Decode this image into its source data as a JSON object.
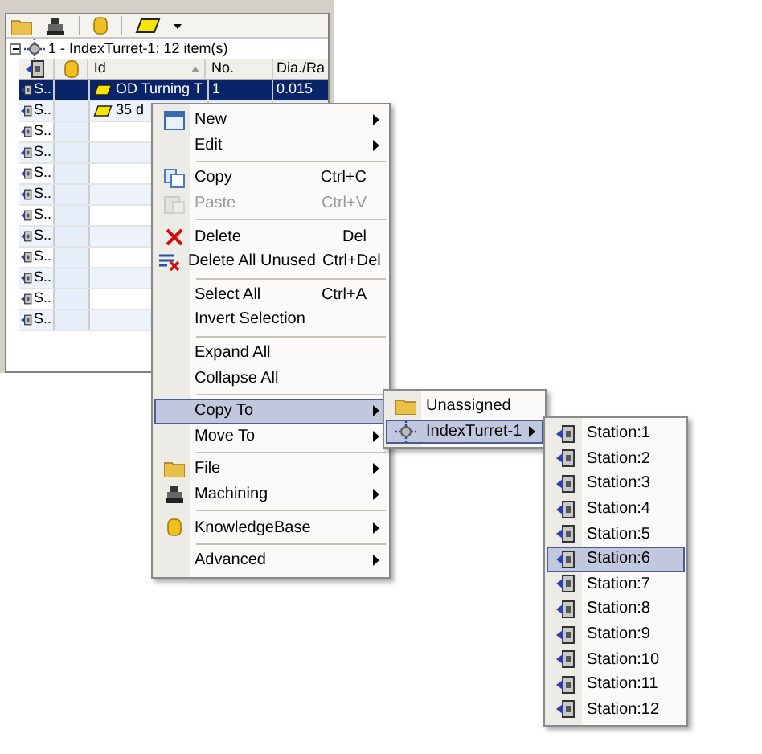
{
  "tree": {
    "label": "1 - IndexTurret-1: 12 item(s)",
    "expanded": true
  },
  "table": {
    "columns": [
      "Id",
      "No.",
      "Dia./Ra"
    ],
    "rows": [
      {
        "station": "S..",
        "id": "OD Turning T",
        "no": "1",
        "dia": "0.015",
        "selected": true
      },
      {
        "station": "S..",
        "id": "35 d",
        "selected": false
      },
      {
        "station": "S..",
        "selected": false
      },
      {
        "station": "S..",
        "selected": false
      },
      {
        "station": "S..",
        "selected": false
      },
      {
        "station": "S..",
        "selected": false
      },
      {
        "station": "S..",
        "selected": false
      },
      {
        "station": "S..",
        "selected": false
      },
      {
        "station": "S..",
        "selected": false
      },
      {
        "station": "S..",
        "selected": false
      },
      {
        "station": "S..",
        "selected": false
      },
      {
        "station": "S..",
        "selected": false
      }
    ]
  },
  "context_menu": {
    "items": [
      {
        "kind": "item",
        "label": "New",
        "submenu": true,
        "disabled": false,
        "selected": false
      },
      {
        "kind": "item",
        "label": "Edit",
        "submenu": true,
        "disabled": false,
        "selected": false
      },
      {
        "kind": "separator"
      },
      {
        "kind": "item",
        "label": "Copy",
        "shortcut": "Ctrl+C",
        "submenu": false,
        "disabled": false,
        "selected": false
      },
      {
        "kind": "item",
        "label": "Paste",
        "shortcut": "Ctrl+V",
        "submenu": false,
        "disabled": true,
        "selected": false
      },
      {
        "kind": "separator"
      },
      {
        "kind": "item",
        "label": "Delete",
        "shortcut": "Del",
        "submenu": false,
        "disabled": false,
        "selected": false
      },
      {
        "kind": "item",
        "label": "Delete All Unused",
        "shortcut": "Ctrl+Del",
        "submenu": false,
        "disabled": false,
        "selected": false
      },
      {
        "kind": "separator"
      },
      {
        "kind": "item",
        "label": "Select All",
        "shortcut": "Ctrl+A",
        "submenu": false,
        "disabled": false,
        "selected": false
      },
      {
        "kind": "item",
        "label": "Invert Selection",
        "submenu": false,
        "disabled": false,
        "selected": false
      },
      {
        "kind": "separator"
      },
      {
        "kind": "item",
        "label": "Expand All",
        "submenu": false,
        "disabled": false,
        "selected": false
      },
      {
        "kind": "item",
        "label": "Collapse All",
        "submenu": false,
        "disabled": false,
        "selected": false
      },
      {
        "kind": "separator"
      },
      {
        "kind": "item",
        "label": "Copy To",
        "submenu": true,
        "disabled": false,
        "selected": true
      },
      {
        "kind": "item",
        "label": "Move To",
        "submenu": true,
        "disabled": false,
        "selected": false
      },
      {
        "kind": "separator"
      },
      {
        "kind": "item",
        "label": "File",
        "submenu": true,
        "disabled": false,
        "selected": false
      },
      {
        "kind": "item",
        "label": "Machining",
        "submenu": true,
        "disabled": false,
        "selected": false
      },
      {
        "kind": "separator"
      },
      {
        "kind": "item",
        "label": "KnowledgeBase",
        "submenu": true,
        "disabled": false,
        "selected": false
      },
      {
        "kind": "separator"
      },
      {
        "kind": "item",
        "label": "Advanced",
        "submenu": true,
        "disabled": false,
        "selected": false
      }
    ]
  },
  "copy_to_menu": {
    "items": [
      {
        "kind": "item",
        "label": "Unassigned",
        "submenu": false,
        "disabled": false,
        "selected": false
      },
      {
        "kind": "item",
        "label": "IndexTurret-1",
        "submenu": true,
        "disabled": false,
        "selected": true
      }
    ]
  },
  "station_menu": {
    "items": [
      {
        "kind": "item",
        "label": "Station:1",
        "submenu": false,
        "disabled": false,
        "selected": false
      },
      {
        "kind": "item",
        "label": "Station:2",
        "submenu": false,
        "disabled": false,
        "selected": false
      },
      {
        "kind": "item",
        "label": "Station:3",
        "submenu": false,
        "disabled": false,
        "selected": false
      },
      {
        "kind": "item",
        "label": "Station:4",
        "submenu": false,
        "disabled": false,
        "selected": false
      },
      {
        "kind": "item",
        "label": "Station:5",
        "submenu": false,
        "disabled": false,
        "selected": false
      },
      {
        "kind": "item",
        "label": "Station:6",
        "submenu": false,
        "disabled": false,
        "selected": true
      },
      {
        "kind": "item",
        "label": "Station:7",
        "submenu": false,
        "disabled": false,
        "selected": false
      },
      {
        "kind": "item",
        "label": "Station:8",
        "submenu": false,
        "disabled": false,
        "selected": false
      },
      {
        "kind": "item",
        "label": "Station:9",
        "submenu": false,
        "disabled": false,
        "selected": false
      },
      {
        "kind": "item",
        "label": "Station:10",
        "submenu": false,
        "disabled": false,
        "selected": false
      },
      {
        "kind": "item",
        "label": "Station:11",
        "submenu": false,
        "disabled": false,
        "selected": false
      },
      {
        "kind": "item",
        "label": "Station:12",
        "submenu": false,
        "disabled": false,
        "selected": false
      }
    ]
  }
}
